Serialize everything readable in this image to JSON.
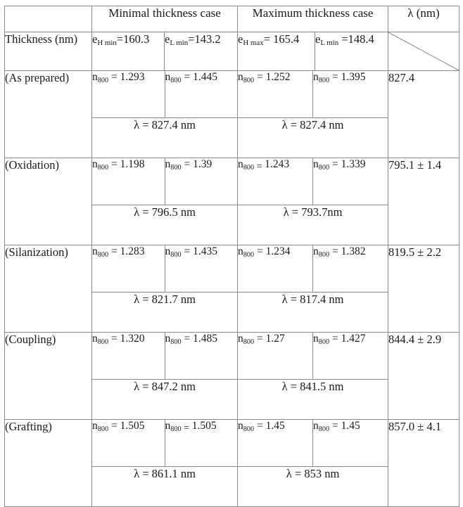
{
  "table": {
    "header": {
      "corner": "",
      "group_min": "Minimal thickness case",
      "group_max": "Maximum thickness case",
      "lambda_col": "λ (nm)"
    },
    "thickness_row": {
      "label": "Thickness (nm)",
      "cells": [
        {
          "symbol": "e",
          "sub": "H min",
          "value": "=160.3"
        },
        {
          "symbol": "e",
          "sub": "L min",
          "value": "=143.2"
        },
        {
          "symbol": "e",
          "sub": "H max",
          "value": "= 165.4"
        },
        {
          "symbol": "e",
          "sub": "L min",
          "value": " =148.4"
        }
      ]
    },
    "rows": [
      {
        "label": "(As prepared)",
        "n_values": [
          {
            "symbol": "n",
            "sub": "800",
            "eq": "=",
            "value": "1.293",
            "lowered_eq": false
          },
          {
            "symbol": "n",
            "sub": "800",
            "eq": "=",
            "value": "1.445",
            "lowered_eq": false
          },
          {
            "symbol": "n",
            "sub": "800",
            "eq": "=",
            "value": "1.252",
            "lowered_eq": false
          },
          {
            "symbol": "n",
            "sub": "800",
            "eq": "=",
            "value": "1.395",
            "lowered_eq": false
          }
        ],
        "lambda_min": "λ = 827.4 nm",
        "lambda_max": "λ = 827.4 nm",
        "lambda_result": "827.4"
      },
      {
        "label": "(Oxidation)",
        "n_values": [
          {
            "symbol": "n",
            "sub": "800",
            "eq": "=",
            "value": "1.198",
            "lowered_eq": false
          },
          {
            "symbol": "n",
            "sub": "800",
            "eq": "=",
            "value": "1.39",
            "lowered_eq": false
          },
          {
            "symbol": "n",
            "sub": "800",
            "eq": "=",
            "value": "1.243",
            "lowered_eq": true
          },
          {
            "symbol": "n",
            "sub": "800",
            "eq": "=",
            "value": "1.339",
            "lowered_eq": false
          }
        ],
        "lambda_min": "λ = 796.5 nm",
        "lambda_max": "λ = 793.7nm",
        "lambda_result": "795.1 ± 1.4"
      },
      {
        "label": "(Silanization)",
        "n_values": [
          {
            "symbol": "n",
            "sub": "800",
            "eq": "=",
            "value": "1.283",
            "lowered_eq": false
          },
          {
            "symbol": "n",
            "sub": "800",
            "eq": "=",
            "value": "1.435",
            "lowered_eq": false
          },
          {
            "symbol": "n",
            "sub": "800",
            "eq": "=",
            "value": "1.234",
            "lowered_eq": false
          },
          {
            "symbol": "n",
            "sub": "800",
            "eq": "=",
            "value": "1.382",
            "lowered_eq": false
          }
        ],
        "lambda_min": "λ = 821.7 nm",
        "lambda_max": "λ = 817.4 nm",
        "lambda_result": "819.5 ± 2.2"
      },
      {
        "label": "(Coupling)",
        "n_values": [
          {
            "symbol": "n",
            "sub": "800",
            "eq": "=",
            "value": "1.320",
            "lowered_eq": false
          },
          {
            "symbol": "n",
            "sub": "800",
            "eq": "=",
            "value": "1.485",
            "lowered_eq": false
          },
          {
            "symbol": "n",
            "sub": "800",
            "eq": "=",
            "value": "1.27",
            "lowered_eq": false
          },
          {
            "symbol": "n",
            "sub": "800",
            "eq": "=",
            "value": "1.427",
            "lowered_eq": false
          }
        ],
        "lambda_min": "λ = 847.2 nm",
        "lambda_max": "λ = 841.5 nm",
        "lambda_result": "844.4 ± 2.9"
      },
      {
        "label": "(Grafting)",
        "n_values": [
          {
            "symbol": "n",
            "sub": "800",
            "eq": "=",
            "value": "1.505",
            "lowered_eq": false
          },
          {
            "symbol": "n",
            "sub": "800",
            "eq": "=",
            "value": "1.505",
            "lowered_eq": true
          },
          {
            "symbol": "n",
            "sub": "800",
            "eq": "=",
            "value": "1.45",
            "lowered_eq": false
          },
          {
            "symbol": "n",
            "sub": "800",
            "eq": "=",
            "value": "1.45",
            "lowered_eq": false
          }
        ],
        "lambda_min": "λ = 861.1 nm",
        "lambda_max": "λ = 853 nm",
        "lambda_result": "857.0 ± 4.1"
      }
    ]
  },
  "style": {
    "border_color": "#8a8a8a",
    "text_color": "#1a1a1a",
    "background": "#ffffff"
  }
}
